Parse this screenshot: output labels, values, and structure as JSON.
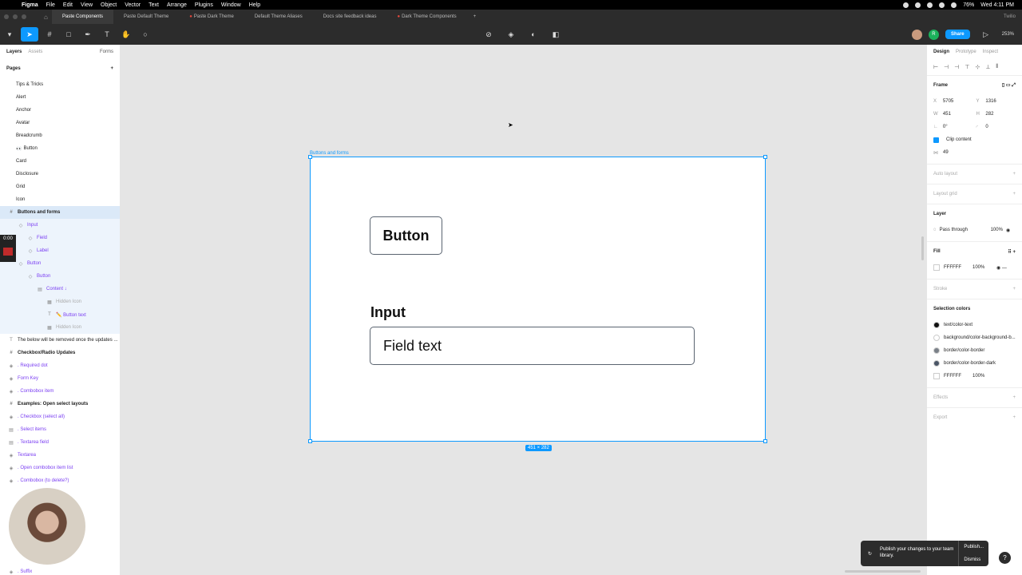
{
  "menubar": {
    "app": "Figma",
    "items": [
      "File",
      "Edit",
      "View",
      "Object",
      "Vector",
      "Text",
      "Arrange",
      "Plugins",
      "Window",
      "Help"
    ],
    "battery": "76%",
    "clock": "Wed 4:11 PM"
  },
  "tabs": {
    "items": [
      {
        "label": "Paste Components",
        "active": true,
        "red": false
      },
      {
        "label": "Paste Default Theme",
        "active": false,
        "red": false
      },
      {
        "label": "Paste Dark Theme",
        "active": false,
        "red": true
      },
      {
        "label": "Default Theme Aliases",
        "active": false,
        "red": false
      },
      {
        "label": "Docs site feedback ideas",
        "active": false,
        "red": false
      },
      {
        "label": "Dark Theme Components",
        "active": false,
        "red": true
      }
    ],
    "org": "Twilio"
  },
  "toolbar": {
    "share": "Share",
    "zoom": "253%",
    "collaborator_initial": "R"
  },
  "left_panel": {
    "tab_layers": "Layers",
    "tab_assets": "Assets",
    "page_switch": "Forms",
    "pages_header": "Pages",
    "pages": [
      "Tips & Tricks",
      "Alert",
      "Anchor",
      "Avatar",
      "Breadcrumb",
      "Button",
      "Card",
      "Disclosure",
      "Grid",
      "Icon"
    ],
    "button_page_prefix": "👀",
    "layers": [
      {
        "label": "Buttons and forms",
        "icon": "#",
        "indent": 8,
        "style": "sel bold"
      },
      {
        "label": "Input",
        "icon": "◇",
        "indent": 20,
        "style": "sub purple"
      },
      {
        "label": "Field",
        "icon": "◇",
        "indent": 32,
        "style": "sub purple"
      },
      {
        "label": "Label",
        "icon": "◇",
        "indent": 32,
        "style": "sub purple"
      },
      {
        "label": "Button",
        "icon": "◇",
        "indent": 20,
        "style": "sub purple"
      },
      {
        "label": "Button",
        "icon": "◇",
        "indent": 32,
        "style": "sub purple"
      },
      {
        "label": "Content ↓",
        "icon": "▤",
        "indent": 44,
        "style": "sub purple"
      },
      {
        "label": "Hidden Icon",
        "icon": "▦",
        "indent": 56,
        "style": "sub dim"
      },
      {
        "label": "✏️ Button text",
        "icon": "T",
        "indent": 56,
        "style": "sub purple"
      },
      {
        "label": "Hidden Icon",
        "icon": "▦",
        "indent": 56,
        "style": "sub dim"
      },
      {
        "label": "The below will be removed once the updates ...",
        "icon": "T",
        "indent": 8,
        "style": ""
      },
      {
        "label": "Checkbox/Radio Updates",
        "icon": "#",
        "indent": 8,
        "style": "bold"
      },
      {
        "label": ". Required dot",
        "icon": "◈",
        "indent": 8,
        "style": "purple"
      },
      {
        "label": "Form Key",
        "icon": "◈",
        "indent": 8,
        "style": "purple"
      },
      {
        "label": ". Combobox item",
        "icon": "◈",
        "indent": 8,
        "style": "purple"
      },
      {
        "label": "Examples: Open select layouts",
        "icon": "#",
        "indent": 8,
        "style": "bold"
      },
      {
        "label": ". Checkbox (select all)",
        "icon": "◈",
        "indent": 8,
        "style": "purple"
      },
      {
        "label": ". Select items",
        "icon": "▤",
        "indent": 8,
        "style": "purple"
      },
      {
        "label": ". Textarea field",
        "icon": "▤",
        "indent": 8,
        "style": "purple"
      },
      {
        "label": "Textarea",
        "icon": "◈",
        "indent": 8,
        "style": "purple"
      },
      {
        "label": ". Open combobox item list",
        "icon": "◈",
        "indent": 8,
        "style": "purple"
      },
      {
        "label": ". Combobox (to delete?)",
        "icon": "◈",
        "indent": 8,
        "style": "purple"
      }
    ],
    "bottom_layer": ". Suffix"
  },
  "canvas": {
    "frame_name": "Buttons and forms",
    "frame_size": "451 × 282",
    "button_text": "Button",
    "input_label": "Input",
    "field_text": "Field text"
  },
  "right_panel": {
    "tab_design": "Design",
    "tab_prototype": "Prototype",
    "tab_inspect": "Inspect",
    "frame_label": "Frame",
    "x": "5705",
    "y": "1316",
    "w": "451",
    "h": "282",
    "rotation": "0°",
    "radius": "0",
    "clip_content": "Clip content",
    "gap": "49",
    "auto_layout": "Auto layout",
    "layout_grid": "Layout grid",
    "layer_label": "Layer",
    "blend": "Pass through",
    "opacity": "100%",
    "fill_label": "Fill",
    "fill_hex": "FFFFFF",
    "fill_opacity": "100%",
    "stroke_label": "Stroke",
    "selection_colors_label": "Selection colors",
    "selection_colors": [
      {
        "name": "text/color-text",
        "color": "#111111"
      },
      {
        "name": "background/color-background-b...",
        "color": "#ffffff"
      },
      {
        "name": "border/color-border",
        "color": "#7a8088"
      },
      {
        "name": "border/color-border-dark",
        "color": "#4a5566"
      }
    ],
    "sel_hex": "FFFFFF",
    "sel_opacity": "100%",
    "effects_label": "Effects",
    "export_label": "Export"
  },
  "recording": {
    "time": "0:00"
  },
  "toast": {
    "message": "Publish your changes to your team library.",
    "publish": "Publish...",
    "dismiss": "Dismiss"
  }
}
